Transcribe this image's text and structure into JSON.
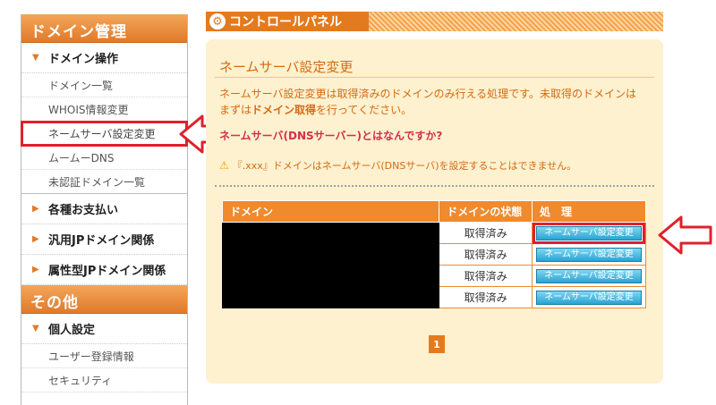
{
  "sidebar": {
    "domain_header": "ドメイン管理",
    "domain_ops": "ドメイン操作",
    "items": [
      "ドメイン一覧",
      "WHOIS情報変更",
      "ネームサーバ設定変更",
      "ムームーDNS",
      "未認証ドメイン一覧"
    ],
    "payments": "各種お支払い",
    "general_jp": "汎用JPドメイン関係",
    "attr_jp": "属性型JPドメイン関係",
    "other_header": "その他",
    "personal": "個人設定",
    "personal_items": [
      "ユーザー登録情報",
      "セキュリティ"
    ]
  },
  "control_panel": {
    "title": "コントロールパネル"
  },
  "panel": {
    "title": "ネームサーバ設定変更",
    "desc_1": "ネームサーバ設定変更は取得済みのドメインのみ行える処理です。未取得のドメインは",
    "desc_2a": "まずは",
    "desc_2b": "ドメイン取得",
    "desc_2c": "を行ってください。",
    "faq": "ネームサーバ(DNSサーバー)とはなんですか?",
    "warning": "『.xxx』ドメインはネームサーバ(DNSサーバ)を設定することはできません。"
  },
  "table": {
    "headers": [
      "ドメイン",
      "ドメインの状態",
      "処　理"
    ],
    "rows": [
      {
        "status": "取得済み",
        "action": "ネームサーバ設定変更"
      },
      {
        "status": "取得済み",
        "action": "ネームサーバ設定変更"
      },
      {
        "status": "取得済み",
        "action": "ネームサーバ設定変更"
      },
      {
        "status": "取得済み",
        "action": "ネームサーバ設定変更"
      }
    ]
  },
  "pager": {
    "current": "1"
  },
  "colors": {
    "accent": "#e47a1e",
    "highlight": "#e0202a"
  }
}
